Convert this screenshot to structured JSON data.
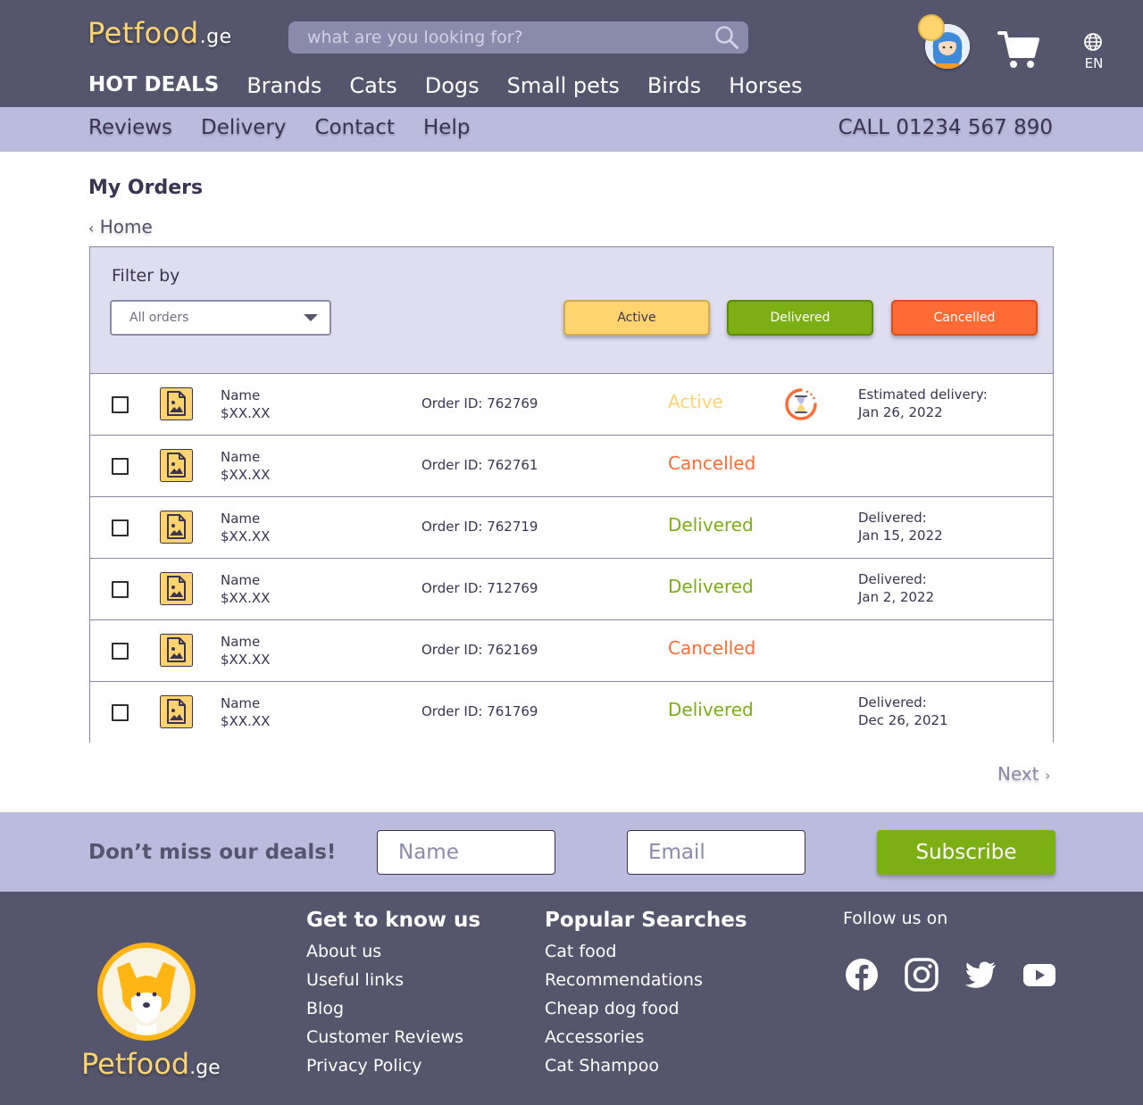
{
  "header": {
    "logo_main": "Petfood",
    "logo_tld": ".ge",
    "search_placeholder": "what are you looking for?",
    "language": "EN",
    "nav": [
      "HOT DEALS",
      "Brands",
      "Cats",
      "Dogs",
      "Small pets",
      "Birds",
      "Horses"
    ]
  },
  "subnav": {
    "links": [
      "Reviews",
      "Delivery",
      "Contact",
      "Help"
    ],
    "call": "CALL 01234 567 890"
  },
  "main": {
    "title": "My Orders",
    "breadcrumb": "Home",
    "filter_label": "Filter by",
    "filter_select": "All orders",
    "filter_buttons": {
      "active": "Active",
      "delivered": "Delivered",
      "cancelled": "Cancelled"
    },
    "orders": [
      {
        "name": "Name",
        "price": "$XX.XX",
        "order_id": "Order ID: 762769",
        "status": "Active",
        "status_type": "active",
        "date_label": "Estimated delivery:",
        "date": "Jan 26, 2022",
        "pending_icon": true
      },
      {
        "name": "Name",
        "price": "$XX.XX",
        "order_id": "Order ID: 762761",
        "status": "Cancelled",
        "status_type": "cancelled",
        "date_label": "",
        "date": ""
      },
      {
        "name": "Name",
        "price": "$XX.XX",
        "order_id": "Order ID: 762719",
        "status": "Delivered",
        "status_type": "delivered",
        "date_label": "Delivered:",
        "date": "Jan 15, 2022"
      },
      {
        "name": "Name",
        "price": "$XX.XX",
        "order_id": "Order ID: 712769",
        "status": "Delivered",
        "status_type": "delivered",
        "date_label": "Delivered:",
        "date": "Jan 2, 2022"
      },
      {
        "name": "Name",
        "price": "$XX.XX",
        "order_id": "Order ID: 762169",
        "status": "Cancelled",
        "status_type": "cancelled",
        "date_label": "",
        "date": ""
      },
      {
        "name": "Name",
        "price": "$XX.XX",
        "order_id": "Order ID: 761769",
        "status": "Delivered",
        "status_type": "delivered",
        "date_label": "Delivered:",
        "date": "Dec 26, 2021"
      }
    ],
    "next": "Next"
  },
  "newsletter": {
    "title": "Don’t miss our deals!",
    "name_placeholder": "Name",
    "email_placeholder": "Email",
    "subscribe": "Subscribe"
  },
  "footer": {
    "col1_title": "Get to know us",
    "col1_links": [
      "About us",
      "Useful links",
      "Blog",
      "Customer Reviews",
      "Privacy Policy"
    ],
    "col2_title": "Popular Searches",
    "col2_links": [
      "Cat food",
      "Recommendations",
      "Cheap dog food",
      "Accessories",
      "Cat Shampoo"
    ],
    "follow": "Follow us on",
    "social": [
      "facebook-icon",
      "instagram-icon",
      "twitter-icon",
      "youtube-icon"
    ]
  },
  "colors": {
    "header_bg": "#55566e",
    "subnav_bg": "#bbbbdd",
    "filter_bg": "#dedef0",
    "active": "#ffd36e",
    "delivered": "#7caf13",
    "cancelled": "#ff6b35",
    "brand_yellow": "#ffd36e"
  }
}
